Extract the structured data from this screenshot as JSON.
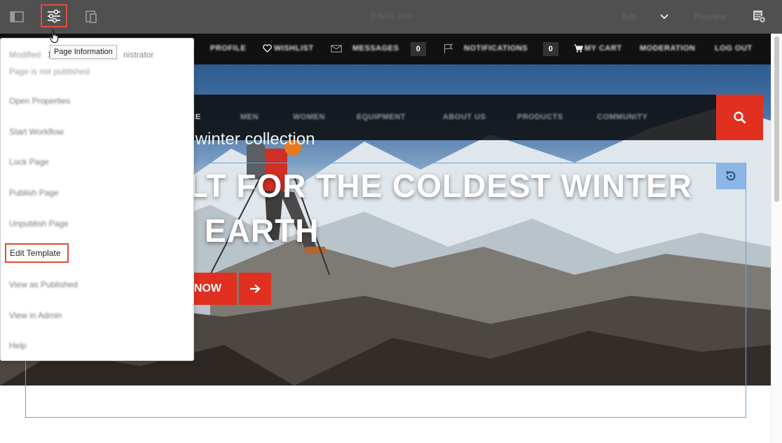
{
  "editor_bar": {
    "title": "ENGLISH",
    "mode": "Edit",
    "preview_label": "Preview",
    "icons": [
      "side-panel-icon",
      "page-information-icon",
      "emulator-icon",
      "chevron-down-icon",
      "annotate-icon"
    ]
  },
  "tooltip": "Page Information",
  "page_info_panel": {
    "modified_prefix": "1",
    "modified_by": "nistrator",
    "modified_hidden": "Modified",
    "publish_status": "Page is not published",
    "items": [
      "Open Properties",
      "Start Workflow",
      "Lock Page",
      "Publish Page",
      "Unpublish Page",
      "Edit Template",
      "View as Published",
      "View in Admin",
      "Help"
    ]
  },
  "site": {
    "top_nav": {
      "profile": "PROFILE",
      "wishlist": "WISHLIST",
      "messages": "MESSAGES",
      "messages_count": "0",
      "notifications": "NOTIFICATIONS",
      "notifications_count": "0",
      "cart": "MY CART",
      "moderation": "MODERATION",
      "logout": "LOG OUT"
    },
    "main_nav": [
      "NCE",
      "MEN",
      "WOMEN",
      "EQUIPMENT",
      "ABOUT US",
      "PRODUCTS",
      "COMMUNITY"
    ],
    "hero": {
      "subheadline": "v winter collection",
      "headline_line1": "ILT FOR THE COLDEST WINTER",
      "headline_line2": "EARTH",
      "cta": "NOW"
    }
  },
  "colors": {
    "editor_bar": "#505050",
    "accent_red": "#e1301f",
    "highlight_red": "#e34b3a",
    "selection_blue": "#6aa3d9"
  }
}
